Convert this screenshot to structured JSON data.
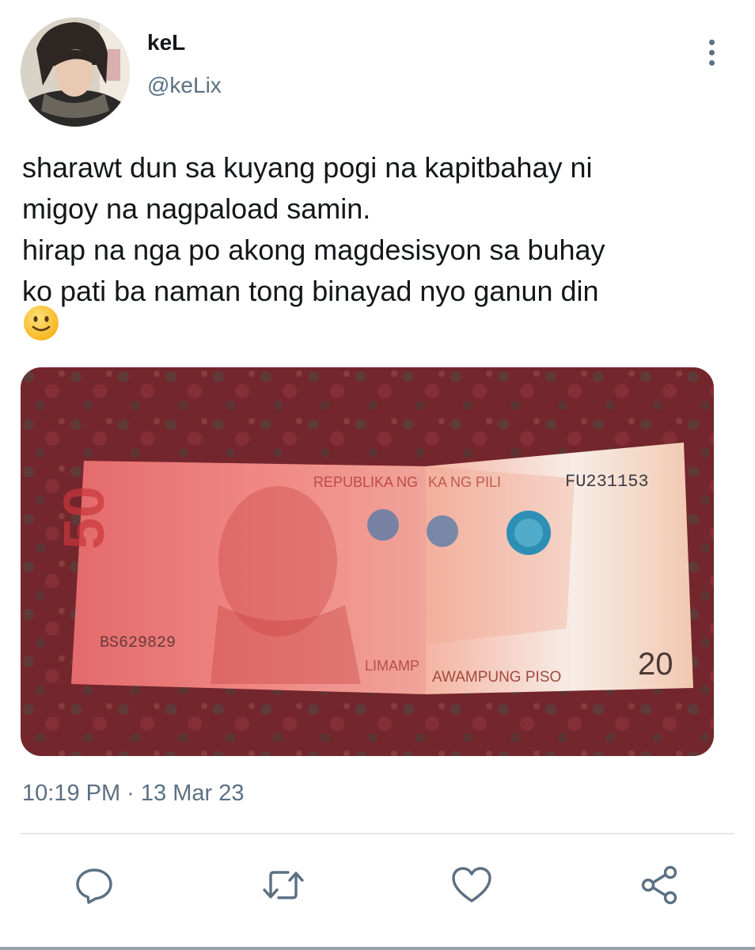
{
  "author": {
    "display_name": "keL",
    "handle": "@keLix"
  },
  "tweet": {
    "text": "sharawt dun sa kuyang pogi na kapitbahay ni\nmigoy na nagpaload samin.\nhirap na nga po akong magdesisyon sa buhay\nko pati ba naman tong binayad nyo ganun din",
    "emoji": "slightly-smiling-face",
    "timestamp": "10:19 PM · 13 Mar 23"
  },
  "media": {
    "banknote_header_left": "REPUBLIKA NG",
    "banknote_header_right": "KA NG PILI",
    "banknote_serial_top": "FU231153",
    "banknote_serial_left": "BS629829",
    "banknote_left_value": "50",
    "banknote_right_value": "20",
    "banknote_bottom_left": "LIMAMP",
    "banknote_bottom_right": "AWAMPUNG PISO"
  },
  "actions": [
    {
      "icon": "reply-icon"
    },
    {
      "icon": "retweet-icon"
    },
    {
      "icon": "like-icon"
    },
    {
      "icon": "share-icon"
    }
  ],
  "colors": {
    "text": "#14171a",
    "secondary": "#5b7083",
    "divider": "#e1e8ed"
  }
}
